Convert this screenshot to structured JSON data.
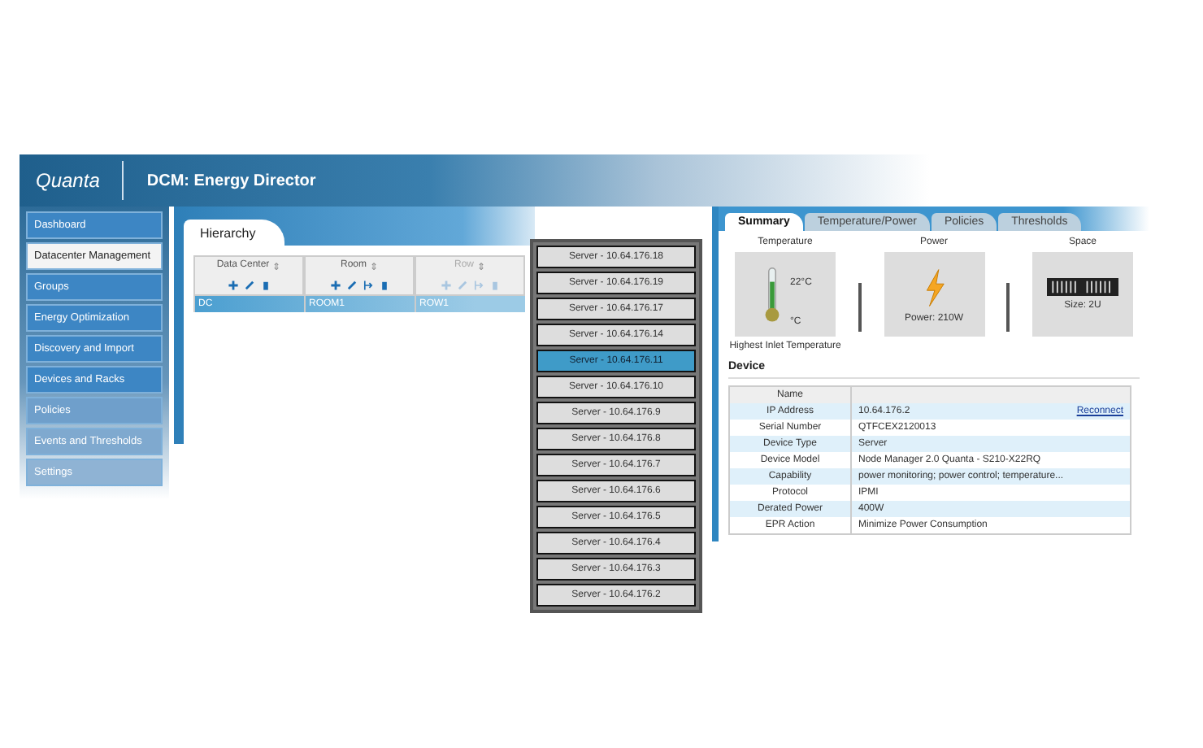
{
  "header": {
    "logo": "Quanta",
    "title": "DCM: Energy Director"
  },
  "sidebar": {
    "items": [
      {
        "label": "Dashboard",
        "selected": false
      },
      {
        "label": "Datacenter Management",
        "selected": true
      },
      {
        "label": "Groups",
        "selected": false
      },
      {
        "label": "Energy Optimization",
        "selected": false
      },
      {
        "label": "Discovery and Import",
        "selected": false
      },
      {
        "label": "Devices and Racks",
        "selected": false
      },
      {
        "label": "Policies",
        "selected": false
      },
      {
        "label": "Events and Thresholds",
        "selected": false
      },
      {
        "label": "Settings",
        "selected": false
      }
    ]
  },
  "hierarchy": {
    "tab": "Hierarchy",
    "columns": [
      {
        "label": "Data Center",
        "sort": "⇕",
        "disabled": false,
        "tools": [
          {
            "kind": "add"
          },
          {
            "kind": "edit"
          },
          {
            "kind": "delete"
          }
        ]
      },
      {
        "label": "Room",
        "sort": "⇕",
        "disabled": false,
        "tools": [
          {
            "kind": "add"
          },
          {
            "kind": "edit"
          },
          {
            "kind": "move"
          },
          {
            "kind": "delete"
          }
        ]
      },
      {
        "label": "Row",
        "sort": "⇕",
        "disabled": true,
        "tools": [
          {
            "kind": "add"
          },
          {
            "kind": "edit"
          },
          {
            "kind": "move"
          },
          {
            "kind": "delete"
          }
        ]
      }
    ],
    "rows": [
      {
        "selected": true,
        "cells": [
          "DC",
          "ROOM1",
          "ROW1"
        ]
      }
    ]
  },
  "servers": [
    {
      "label": "Server - 10.64.176.18",
      "selected": false
    },
    {
      "label": "Server - 10.64.176.19",
      "selected": false
    },
    {
      "label": "Server - 10.64.176.17",
      "selected": false
    },
    {
      "label": "Server - 10.64.176.14",
      "selected": false
    },
    {
      "label": "Server - 10.64.176.11",
      "selected": true
    },
    {
      "label": "Server - 10.64.176.10",
      "selected": false
    },
    {
      "label": "Server - 10.64.176.9",
      "selected": false
    },
    {
      "label": "Server - 10.64.176.8",
      "selected": false
    },
    {
      "label": "Server - 10.64.176.7",
      "selected": false
    },
    {
      "label": "Server - 10.64.176.6",
      "selected": false
    },
    {
      "label": "Server - 10.64.176.5",
      "selected": false
    },
    {
      "label": "Server - 10.64.176.4",
      "selected": false
    },
    {
      "label": "Server - 10.64.176.3",
      "selected": false
    },
    {
      "label": "Server - 10.64.176.2",
      "selected": false
    }
  ],
  "detail": {
    "tabs": [
      {
        "label": "Summary",
        "selected": true
      },
      {
        "label": "Temperature/Power",
        "selected": false
      },
      {
        "label": "Policies",
        "selected": false
      },
      {
        "label": "Thresholds",
        "selected": false
      }
    ],
    "cards": [
      {
        "kind": "temperature",
        "title": "Temperature",
        "reading": "22°C",
        "unit": "°C",
        "caption": "Highest Inlet Temperature"
      },
      {
        "kind": "power",
        "title": "Power",
        "reading": "Power: 210W"
      },
      {
        "kind": "space",
        "title": "Space",
        "reading": "Size: 2U"
      }
    ],
    "device": {
      "title": "Device",
      "header": "Name",
      "rows": [
        {
          "name": "IP Address",
          "value": "10.64.176.2",
          "link": "Reconnect"
        },
        {
          "name": "Serial Number",
          "value": "QTFCEX2120013"
        },
        {
          "name": "Device Type",
          "value": "Server"
        },
        {
          "name": "Device Model",
          "value": "Node Manager 2.0 Quanta - S210-X22RQ"
        },
        {
          "name": "Capability",
          "value": "power monitoring; power control; temperature..."
        },
        {
          "name": "Protocol",
          "value": "IPMI"
        },
        {
          "name": "Derated Power",
          "value": "400W"
        },
        {
          "name": "EPR Action",
          "value": "Minimize Power Consumption"
        }
      ]
    }
  }
}
